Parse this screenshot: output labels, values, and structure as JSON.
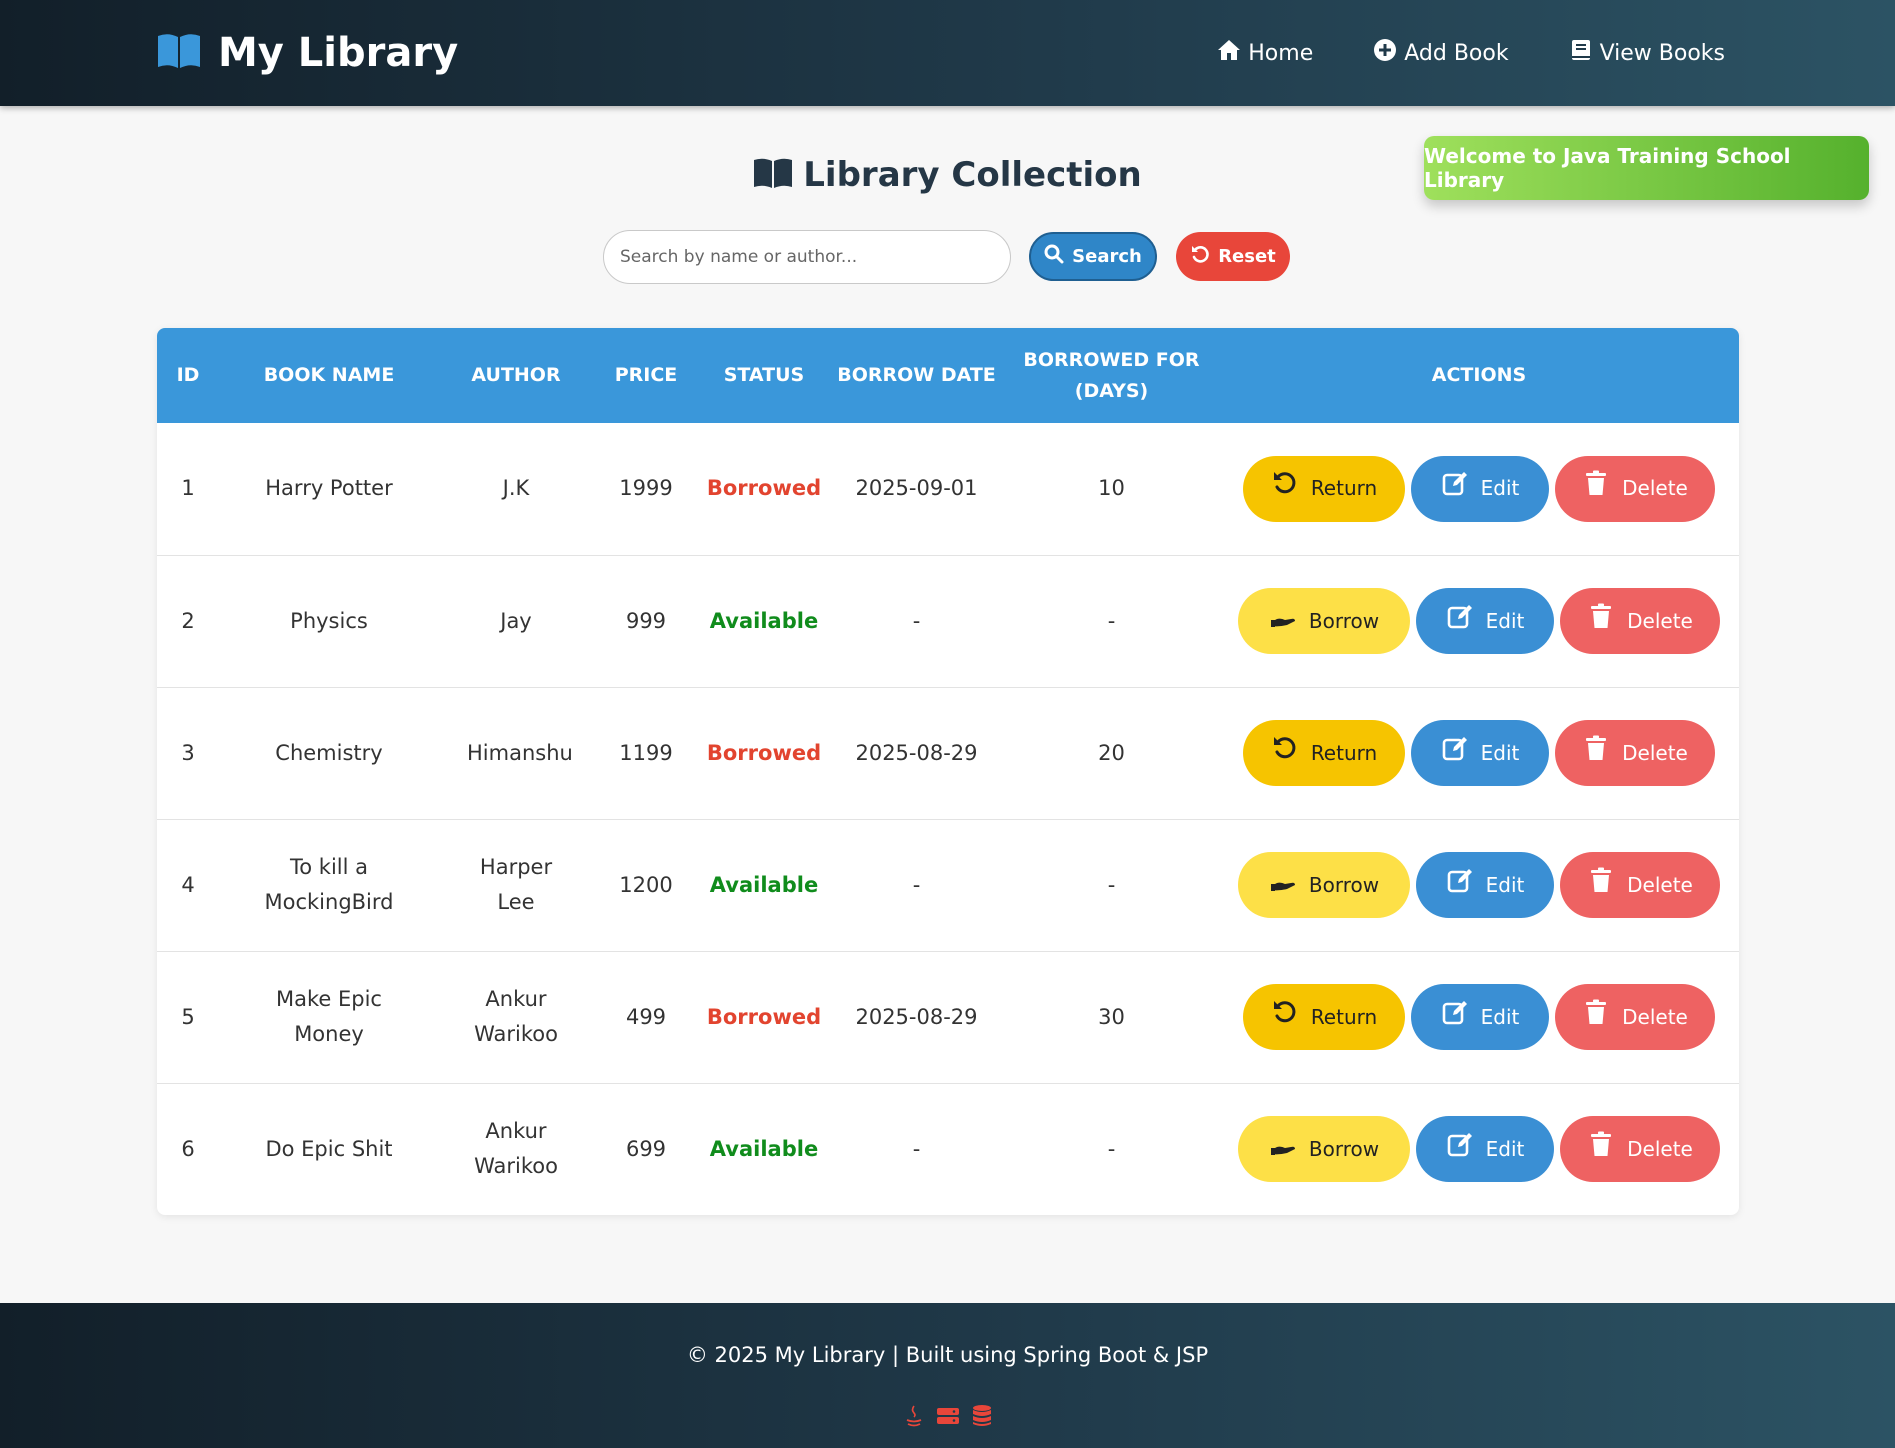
{
  "brand": {
    "name": "My Library",
    "icon": "book-open-icon"
  },
  "nav": [
    {
      "label": "Home",
      "icon": "home-icon"
    },
    {
      "label": "Add Book",
      "icon": "plus-circle-icon"
    },
    {
      "label": "View Books",
      "icon": "book-icon"
    }
  ],
  "welcome": "Welcome to Java Training School Library",
  "page_title": "Library Collection",
  "search": {
    "placeholder": "Search by name or author...",
    "value": "",
    "button_label": "Search",
    "reset_label": "Reset"
  },
  "table": {
    "headers": {
      "id": "ID",
      "name": "Book Name",
      "author": "Author",
      "price": "Price",
      "status": "Status",
      "borrow_date": "Borrow Date",
      "days": "Borrowed For (Days)",
      "actions": "Actions"
    },
    "action_labels": {
      "return": "Return",
      "borrow": "Borrow",
      "edit": "Edit",
      "delete": "Delete"
    },
    "rows": [
      {
        "id": "1",
        "name": "Harry Potter",
        "author": "J.K",
        "price": "1999",
        "status": "Borrowed",
        "borrow_date": "2025-09-01",
        "days": "10"
      },
      {
        "id": "2",
        "name": "Physics",
        "author": "Jay",
        "price": "999",
        "status": "Available",
        "borrow_date": "-",
        "days": "-"
      },
      {
        "id": "3",
        "name": "Chemistry",
        "author": "Himanshu",
        "price": "1199",
        "status": "Borrowed",
        "borrow_date": "2025-08-29",
        "days": "20"
      },
      {
        "id": "4",
        "name": "To kill a MockingBird",
        "author": "Harper Lee",
        "price": "1200",
        "status": "Available",
        "borrow_date": "-",
        "days": "-"
      },
      {
        "id": "5",
        "name": "Make Epic Money",
        "author": "Ankur Warikoo",
        "price": "499",
        "status": "Borrowed",
        "borrow_date": "2025-08-29",
        "days": "30"
      },
      {
        "id": "6",
        "name": "Do Epic Shit",
        "author": "Ankur Warikoo",
        "price": "699",
        "status": "Available",
        "borrow_date": "-",
        "days": "-"
      }
    ]
  },
  "footer": {
    "text": "© 2025 My Library | Built using Spring Boot & JSP",
    "icons": [
      "java-icon",
      "server-icon",
      "database-icon"
    ]
  },
  "colors": {
    "header_bg": "#203a4a",
    "table_header": "#3a97da",
    "borrowed": "#e2442f",
    "available": "#108c1c",
    "return_button": "#f6c400",
    "borrow_button": "#fde047",
    "edit_button": "#3a8fd4",
    "delete_button": "#ee6262",
    "welcome_banner": "#55b12d"
  }
}
